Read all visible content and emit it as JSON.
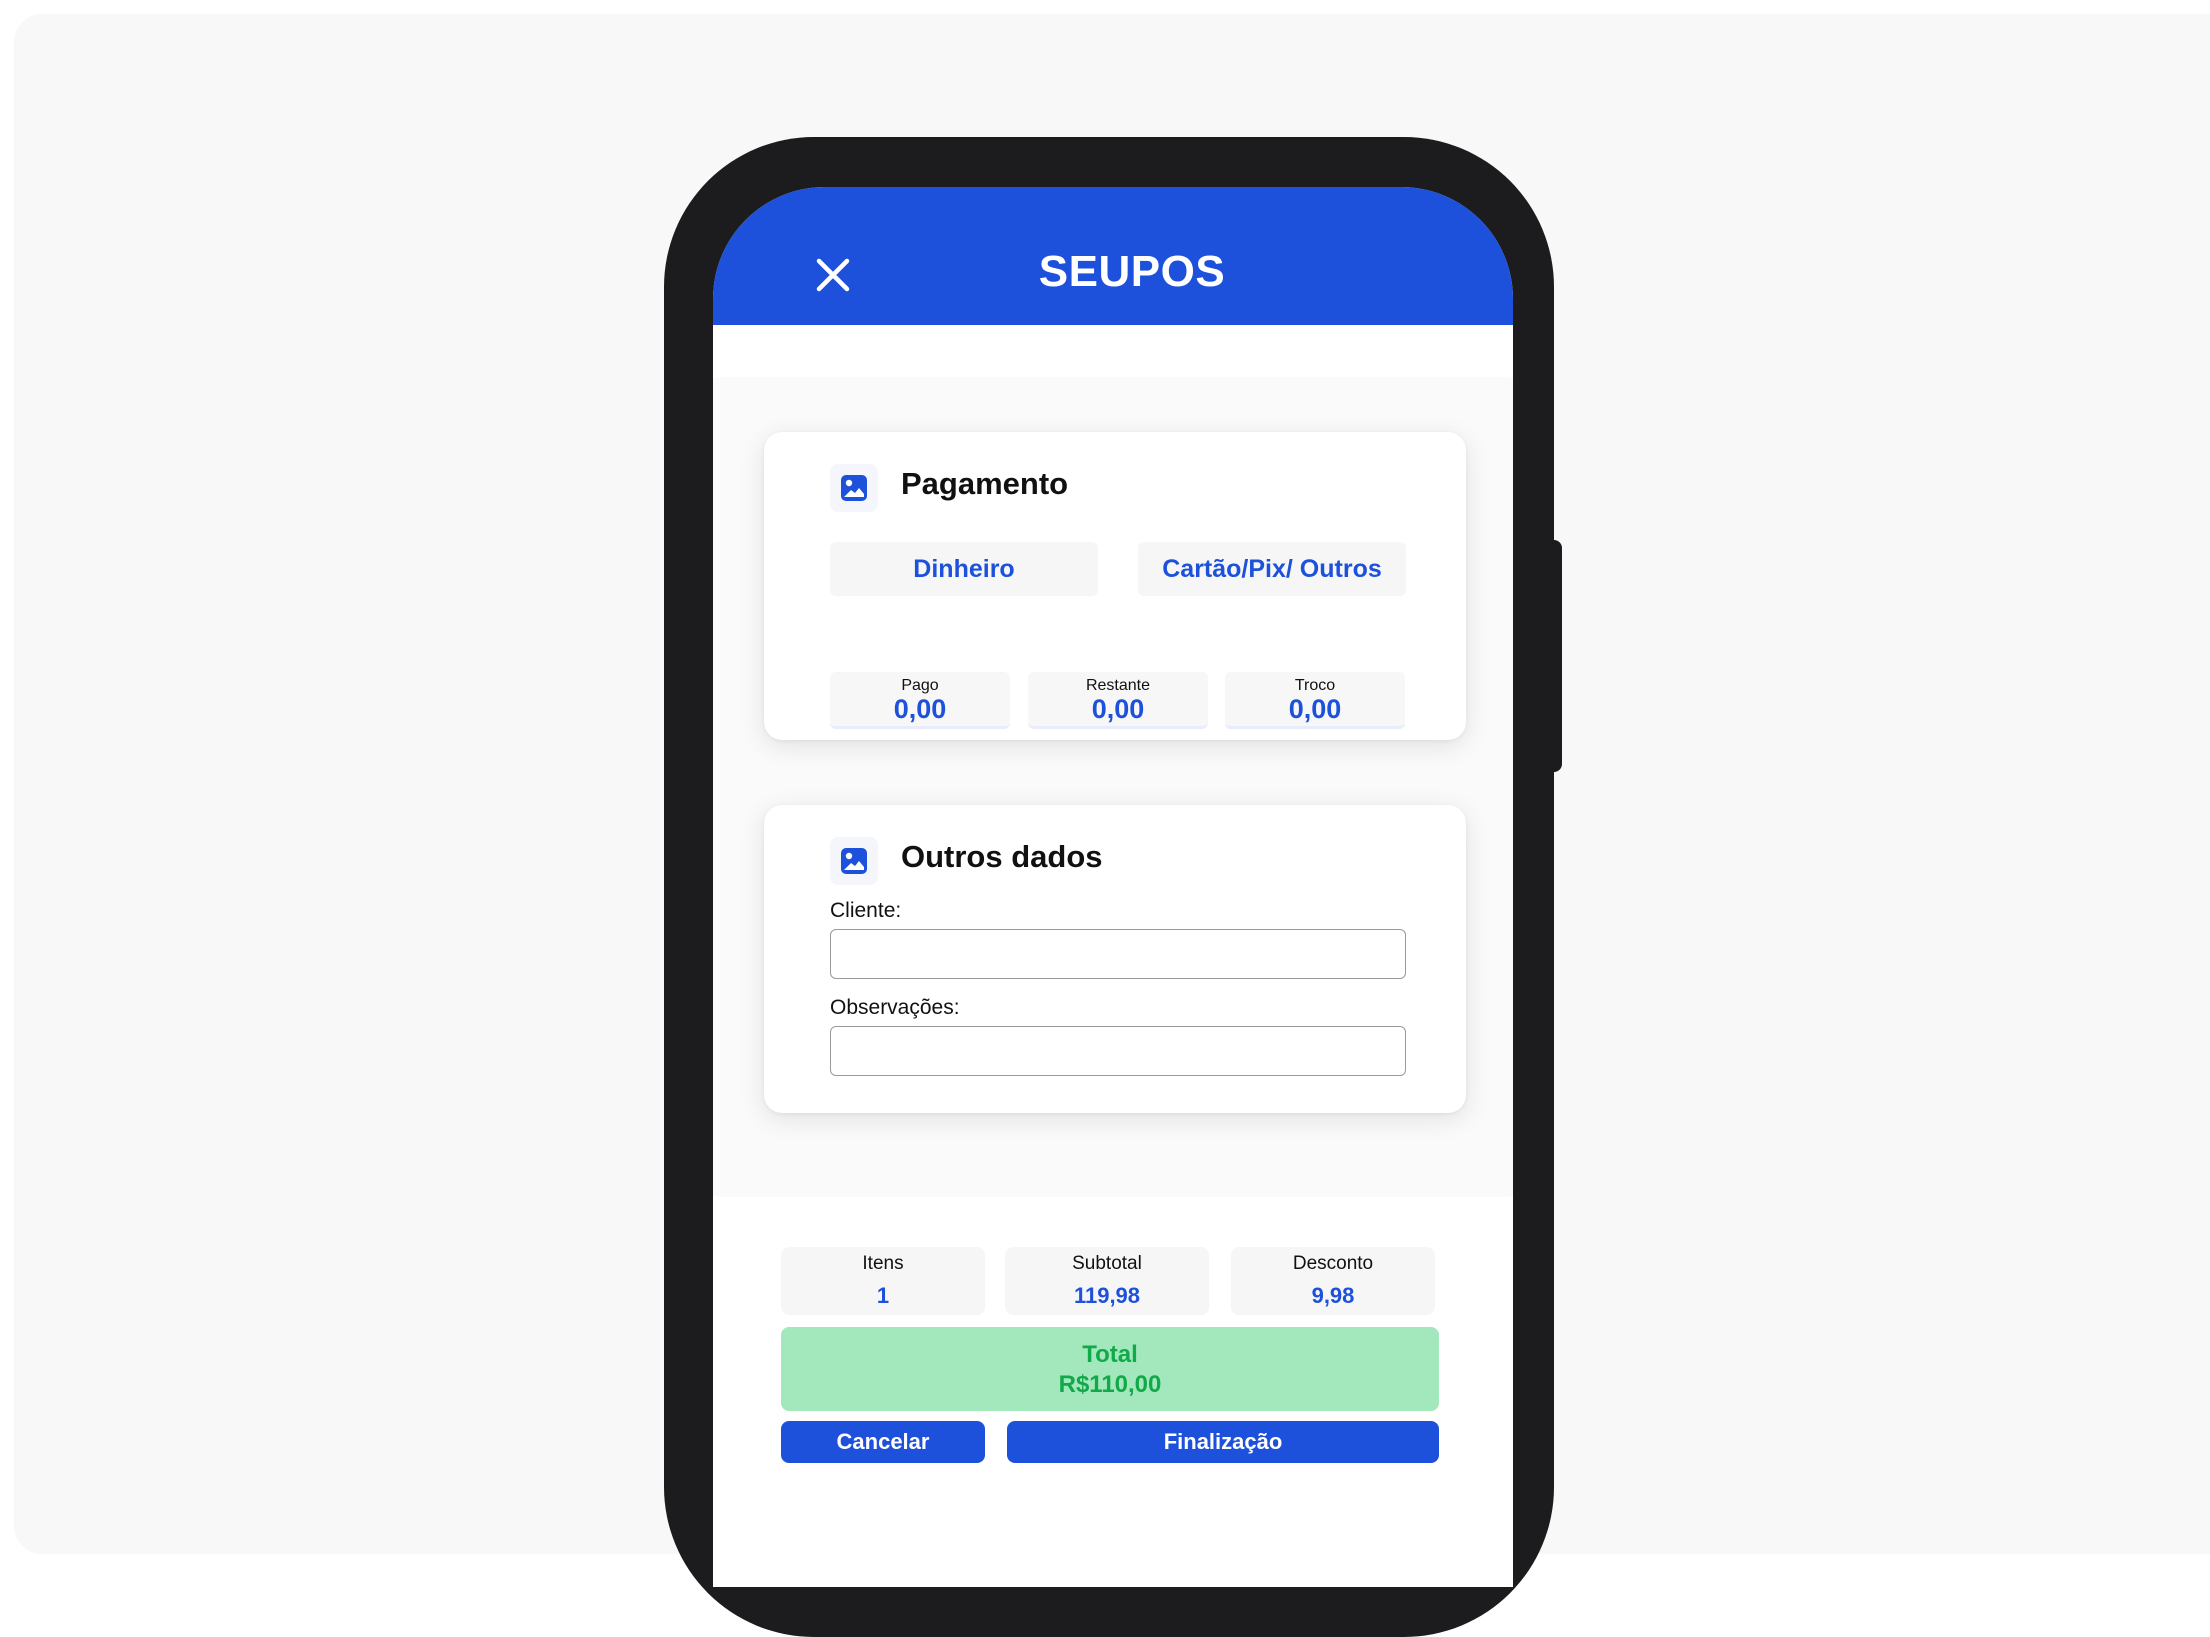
{
  "app": {
    "title": "SEUPOS"
  },
  "colors": {
    "primary": "#1d51db",
    "total_bg": "#a2e8bc",
    "total_text": "#12a94b"
  },
  "icons": {
    "close": "close-icon",
    "section": "image-icon"
  },
  "payment": {
    "title": "Pagamento",
    "methods": [
      "Dinheiro",
      "Cartão/Pix/ Outros"
    ],
    "stats": [
      {
        "label": "Pago",
        "value": "0,00"
      },
      {
        "label": "Restante",
        "value": "0,00"
      },
      {
        "label": "Troco",
        "value": "0,00"
      }
    ]
  },
  "other": {
    "title": "Outros dados",
    "client_label": "Cliente:",
    "client_value": "",
    "notes_label": "Observações:",
    "notes_value": ""
  },
  "summary": {
    "items": [
      {
        "label": "Itens",
        "value": "1"
      },
      {
        "label": "Subtotal",
        "value": "119,98"
      },
      {
        "label": "Desconto",
        "value": "9,98"
      }
    ],
    "total_label": "Total",
    "total_value": "R$110,00"
  },
  "actions": {
    "cancel": "Cancelar",
    "finish": "Finalização"
  }
}
